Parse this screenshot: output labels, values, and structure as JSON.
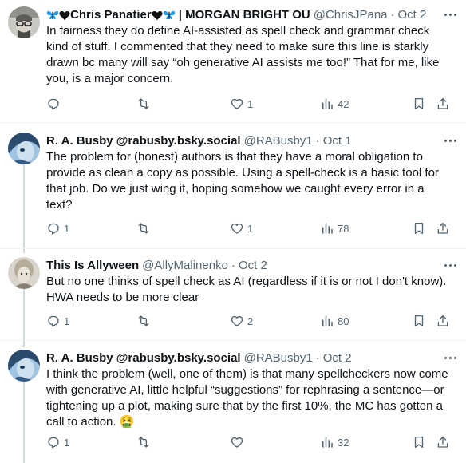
{
  "tweets": [
    {
      "name": "Chris Panatier",
      "name_suffix": "| MORGAN BRIGHT OU",
      "handle": "@ChrisJPana",
      "sep": "·",
      "date": "Oct 2",
      "text": "In fairness they do define AI-assisted as spell check and grammar check kind of stuff. I commented that they need to make sure this line is starkly drawn bc many will say “oh generative AI assists me too!” That for me, like you, is a major concern.",
      "replies": "",
      "reposts": "",
      "likes": "1",
      "views": "42"
    },
    {
      "name": "R. A. Busby @rabusby.bsky.social",
      "handle": "@RABusby1",
      "sep": "·",
      "date": "Oct 1",
      "text": "The problem for (honest) authors is that they have a moral obligation to provide as clean a copy as possible. Using a spell-check is a basic tool for that job. Do we just wing it, hoping somehow we caught every error in a text?",
      "replies": "1",
      "reposts": "",
      "likes": "1",
      "views": "78"
    },
    {
      "name": "This Is Allyween",
      "handle": "@AllyMalinenko",
      "sep": "·",
      "date": "Oct 2",
      "text": "But no one thinks of spell check as AI (regardless if it is or not I don't know). HWA needs to be more clear",
      "replies": "1",
      "reposts": "",
      "likes": "2",
      "views": "80"
    },
    {
      "name": "R. A. Busby @rabusby.bsky.social",
      "handle": "@RABusby1",
      "sep": "·",
      "date": "Oct 2",
      "text": "I think the problem (well, one of them) is that many spellcheckers now come with generative AI, little helpful “suggestions” for rephrasing a sentence—or tightening up a plot, making sure that by the first 10%, the MC has gotten a call to action. 🤮",
      "replies": "1",
      "reposts": "",
      "likes": "",
      "views": "32"
    }
  ],
  "colors": {
    "text": "#0f1419",
    "muted": "#536471",
    "butterfly": "#1d9bf0",
    "divider": "#eff3f4",
    "thread": "#cfd9de"
  }
}
